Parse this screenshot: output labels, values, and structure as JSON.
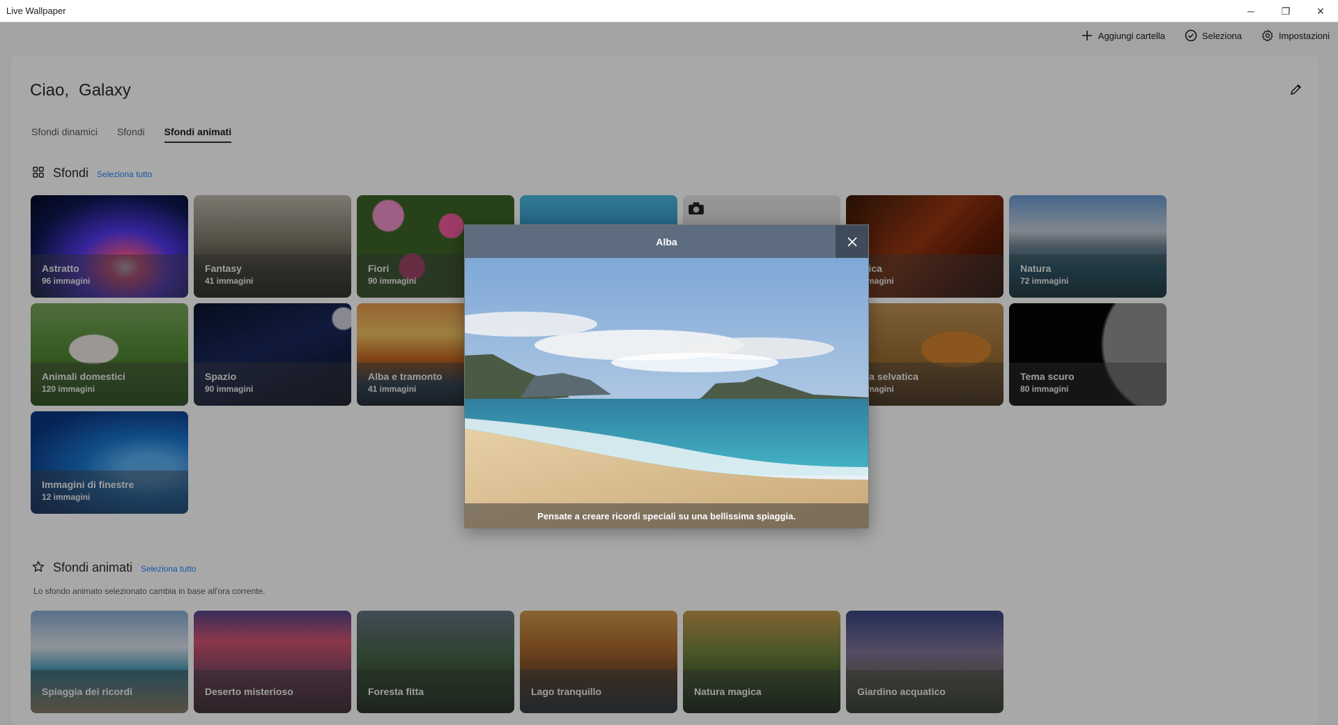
{
  "window": {
    "title": "Live Wallpaper",
    "minimize": "─",
    "restore": "❐",
    "close": "✕"
  },
  "commands": {
    "add_folder": "Aggiungi cartella",
    "select": "Seleziona",
    "settings": "Impostazioni"
  },
  "greeting": {
    "hello": "Ciao,",
    "name": "Galaxy"
  },
  "tabs": [
    "Sfondi dinamici",
    "Sfondi",
    "Sfondi animati"
  ],
  "active_tab": "Sfondi animati",
  "wallpapers": {
    "title": "Sfondi",
    "select_all": "Seleziona tutto",
    "items": [
      {
        "name": "Astratto",
        "count": "96 immagini"
      },
      {
        "name": "Fantasy",
        "count": "41 immagini"
      },
      {
        "name": "Fiori",
        "count": "90 immagini"
      },
      {
        "name": "",
        "count": ""
      },
      {
        "name": "",
        "count": ""
      },
      {
        "name": "usica",
        "count": "immagini"
      },
      {
        "name": "Natura",
        "count": "72 immagini"
      },
      {
        "name": "Animali domestici",
        "count": "120 immagini"
      },
      {
        "name": "Spazio",
        "count": "90 immagini"
      },
      {
        "name": "Alba e tramonto",
        "count": "41 immagini"
      },
      {
        "name": "una selvatica",
        "count": "immagini"
      },
      {
        "name": "Tema scuro",
        "count": "80 immagini"
      },
      {
        "name": "Immagini di finestre",
        "count": "12 immagini"
      }
    ]
  },
  "animated": {
    "title": "Sfondi animati",
    "select_all": "Seleziona tutto",
    "description": "Lo sfondo animato selezionato cambia in base all'ora corrente.",
    "items": [
      {
        "name": "Spiaggia dei ricordi"
      },
      {
        "name": "Deserto misterioso"
      },
      {
        "name": "Foresta fitta"
      },
      {
        "name": "Lago tranquillo"
      },
      {
        "name": "Natura magica"
      },
      {
        "name": "Giardino acquatico"
      }
    ]
  },
  "modal": {
    "title": "Alba",
    "caption": "Pensate a creare ricordi speciali su una bellissima spiaggia."
  }
}
